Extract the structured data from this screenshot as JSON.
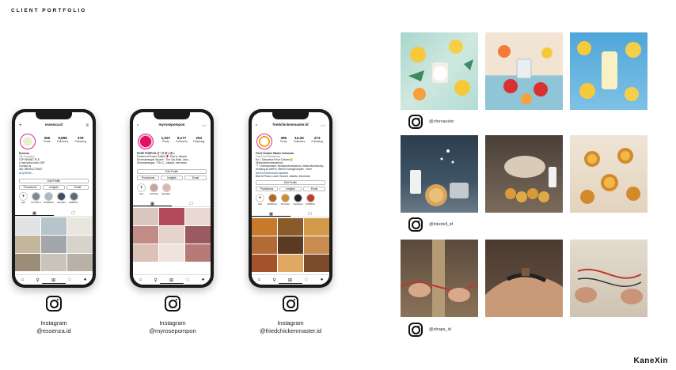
{
  "page": {
    "title": "CLIENT PORTFOLIO",
    "brand": "KaneXin"
  },
  "phones": [
    {
      "username": "essenza.id",
      "stats": [
        {
          "num": "366",
          "lbl": "Posts"
        },
        {
          "num": "5,895",
          "lbl": "Followers"
        },
        {
          "num": "378",
          "lbl": "Following"
        }
      ],
      "bio": [
        "Essenza",
        "Tile Company",
        "TOP BRAND TILE",
        "A Indonesia since 1997",
        "Contact us",
        "WA: 0859011776667",
        "bit.ly/2tH9e..."
      ],
      "buttons_top": [
        "Edit Profile"
      ],
      "buttons": [
        "Promotions",
        "Insights",
        "Email"
      ],
      "highlights": [
        "New",
        "STYLISH VI...",
        "SHOWROOM",
        "GALLERY",
        "WAREHO..."
      ],
      "caption_label": "Instagram",
      "caption_handle": "@essenza.id"
    },
    {
      "username": "myrosepompon",
      "stats": [
        {
          "num": "1,027",
          "lbl": "Posts"
        },
        {
          "num": "9,177",
          "lbl": "Followers"
        },
        {
          "num": "253",
          "lbl": "Following"
        }
      ],
      "bio": [
        "ROSE POMPON ローズ ポンポン",
        "Preserved Flower Gallery 🌹 First in Jakarta",
        "Dharmawangsa Square · The City Walk, Jaka...",
        "Dharmawangsa · F.B.I.C, Jakarta, Indonesia"
      ],
      "buttons_top": [
        "Edit Profile"
      ],
      "buttons": [
        "Promotions",
        "Insights",
        "Email"
      ],
      "highlights": [
        "New",
        "Workshop",
        "Speciallist..."
      ],
      "caption_label": "Instagram",
      "caption_handle": "@myrosepompon"
    },
    {
      "username": "friedchickenmaster.id",
      "stats": [
        {
          "num": "380",
          "lbl": "Posts"
        },
        {
          "num": "14.2K",
          "lbl": "Followers"
        },
        {
          "num": "273",
          "lbl": "Following"
        }
      ],
      "bio": [
        "Fried Chicken Master Indonesia",
        "Fast Food Restaurant",
        "No 1 Taiwanese Fried Chicken😋",
        "#friedchickenmasterindo",
        "📍 Chickenmaster, #makanbersamaindo, #tasteofkoreancity...",
        "Kemang,#CodeFm, Bersih KuningKomplex · more",
        "linktr.ee/friedchickenmasterid",
        "Blok M Plaza, Lower Ground, Jakarta, Indonesia"
      ],
      "buttons_top": [
        "Edit Profile"
      ],
      "buttons": [
        "Promotions",
        "Insights",
        "Email"
      ],
      "highlights": [
        "New",
        "#FCMstory...",
        "Promotion",
        "Instructions",
        "A POPPOL..."
      ],
      "caption_label": "Instagram",
      "caption_handle": "@friedchickenmaster.id"
    }
  ],
  "photo_rows": [
    {
      "handle": "@chevaushc"
    },
    {
      "handle": "@tokotell_id"
    },
    {
      "handle": "@straps_id"
    }
  ],
  "icons": {
    "instagram": "instagram-icon",
    "home": "home-icon",
    "search": "search-icon",
    "add": "add-post-icon",
    "heart": "heart-icon",
    "profile": "profile-icon",
    "grid": "grid-icon",
    "tagged": "tagged-icon"
  },
  "colors": {
    "instagram_ring": "#d6249f",
    "rose_pink": "#e0115f",
    "brand_orange": "#f2a900"
  }
}
